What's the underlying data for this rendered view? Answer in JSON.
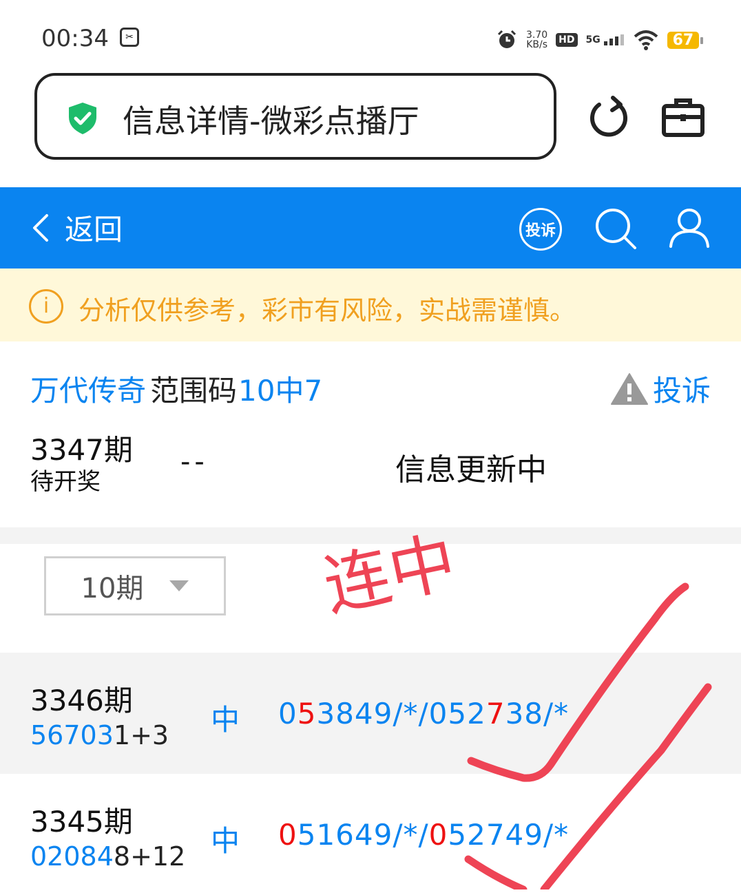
{
  "status_bar": {
    "time": "00:34",
    "net_speed_value": "3.70",
    "net_speed_unit": "KB/s",
    "hd_label": "HD",
    "network_label": "5G",
    "battery": "67"
  },
  "browser": {
    "title": "信息详情-微彩点播厅"
  },
  "header": {
    "back_label": "返回",
    "complain_badge": "投诉"
  },
  "notice": {
    "icon_glyph": "i",
    "text": "分析仅供参考，彩市有风险，实战需谨慎。"
  },
  "detail": {
    "expert_name": "万代传奇",
    "range_label": "范围码",
    "hit_rate": "10中7",
    "report_label": "投诉"
  },
  "current": {
    "period": "3347期",
    "status": "待开奖",
    "dash": "--",
    "info": "信息更新中"
  },
  "filter": {
    "selected": "10期"
  },
  "overlay": {
    "handwritten": "连中",
    "color": "#ee4455"
  },
  "history": [
    {
      "period": "3346期",
      "draw_highlight": "56703",
      "draw_rest": "1+3",
      "result": "中",
      "code_parts": [
        {
          "text": "0",
          "hit": false
        },
        {
          "text": "5",
          "hit": true
        },
        {
          "text": "3849/*/052",
          "hit": false
        },
        {
          "text": "7",
          "hit": true
        },
        {
          "text": "38/*",
          "hit": false
        }
      ]
    },
    {
      "period": "3345期",
      "draw_highlight": "02084",
      "draw_rest": "8+12",
      "result": "中",
      "code_parts": [
        {
          "text": "0",
          "hit": true
        },
        {
          "text": "51649/*/",
          "hit": false
        },
        {
          "text": "0",
          "hit": true
        },
        {
          "text": "52749/*",
          "hit": false
        }
      ]
    }
  ],
  "colors": {
    "brand_blue": "#0a84f0",
    "hit_red": "#ee1111",
    "notice_orange": "#f0a020"
  }
}
